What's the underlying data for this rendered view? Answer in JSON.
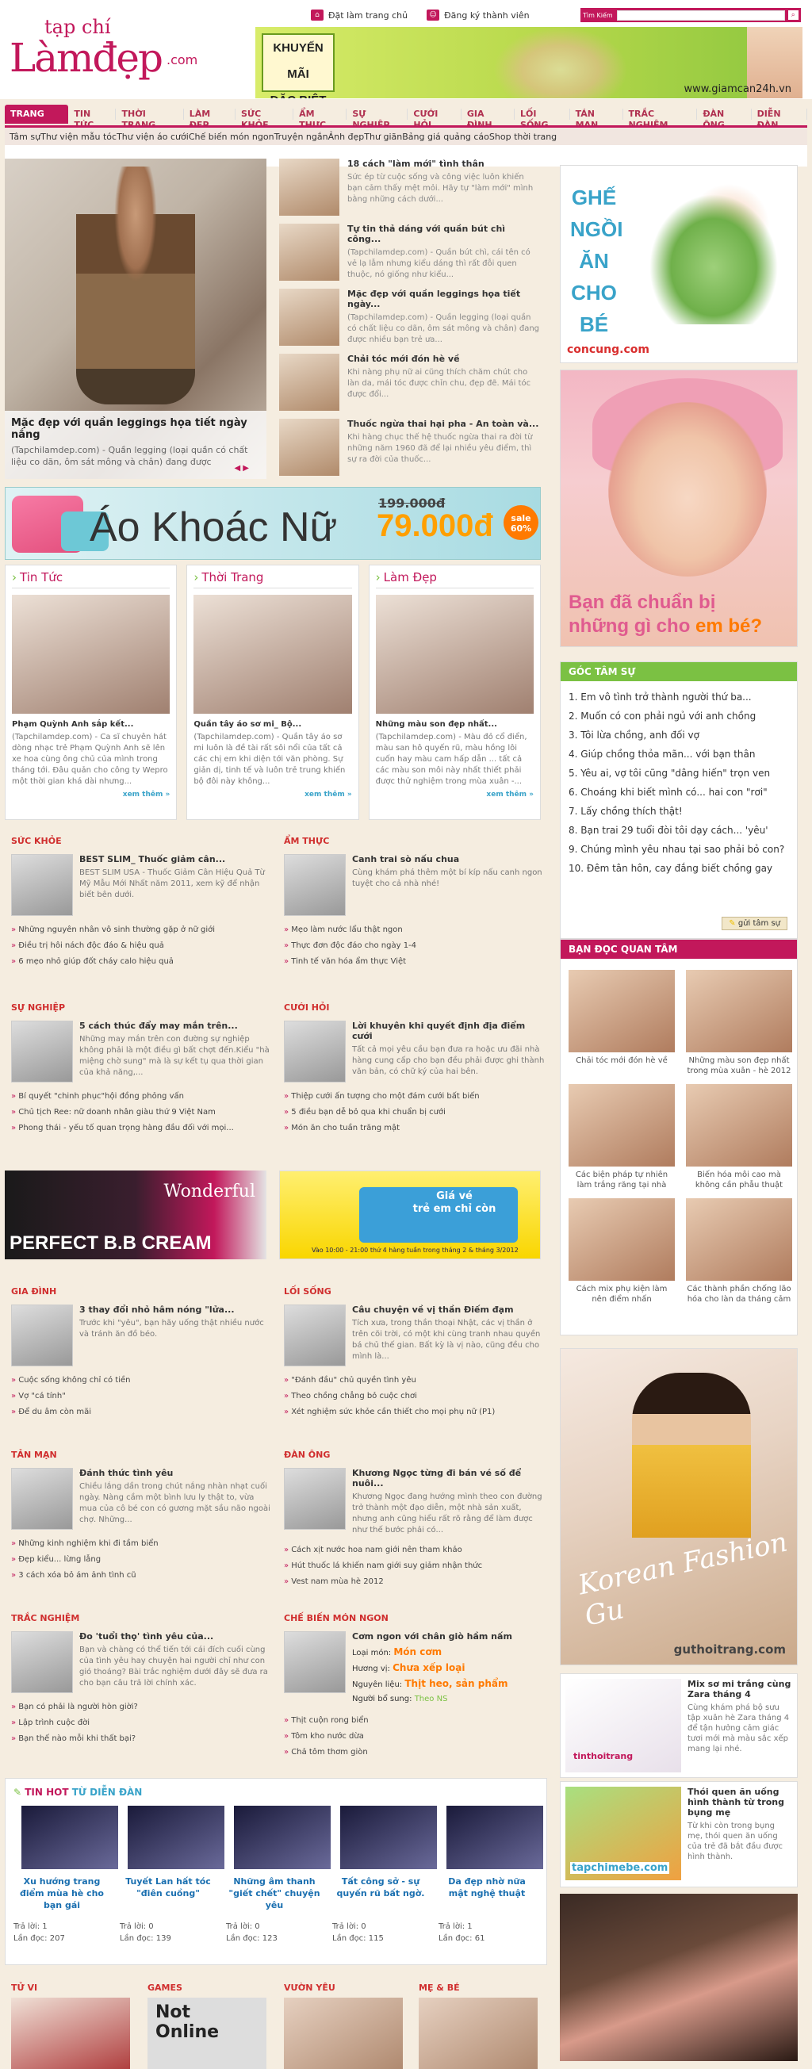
{
  "header": {
    "top_links": {
      "home": "Đặt làm trang chủ",
      "register": "Đăng ký thành viên"
    },
    "search": {
      "label": "Tìm Kiếm",
      "placeholder": ""
    },
    "logo": {
      "small": "tạp chí",
      "big": "Làmđẹp",
      "com": ".com"
    },
    "banner": {
      "line1": "KHUYẾN MÃI",
      "line2": "ĐẶC BIỆT",
      "site": "www.giamcan24h.vn"
    }
  },
  "nav": [
    "TRANG CHỦ",
    "TIN TỨC",
    "THỜI TRANG",
    "LÀM ĐẸP",
    "SỨC KHỎE",
    "ẨM THỰC",
    "SỰ NGHIỆP",
    "CƯỚI HỎI",
    "GIA ĐÌNH",
    "LỐI SỐNG",
    "TÁN MẠN",
    "TRẮC NGHIỆM",
    "ĐÀN ÔNG",
    "DIỄN ĐÀN"
  ],
  "subnav": [
    "Tâm sự",
    "Thư viện mẫu tóc",
    "Thư viện áo cưới",
    "Chế biến món ngon",
    "Truyện ngắn",
    "Ảnh đẹp",
    "Thư giãn",
    "Bảng giá quảng cáo",
    "Shop thời trang"
  ],
  "featured": {
    "title": "Mặc đẹp với quần leggings họa tiết ngày nắng",
    "desc": "(Tapchilamdep.com) - Quần legging (loại quần có chất liệu co dãn, ôm sát mông và chân) đang được"
  },
  "news": [
    {
      "title": "18 cách \"làm mới\" tình thân",
      "desc": "Sức ép từ cuộc sống và công việc luôn khiến bạn cảm thấy mệt mỏi. Hãy tự \"làm mới\" mình bằng những cách dưới..."
    },
    {
      "title": "Tự tin thả dáng với quần bút chì công...",
      "desc": "(Tapchilamdep.com) - Quần bút chì, cái tên có vẻ lạ lẫm nhưng kiểu dáng thì rất đỗi quen thuộc, nó giống như kiểu..."
    },
    {
      "title": "Mặc đẹp với quần leggings họa tiết ngày...",
      "desc": "(Tapchilamdep.com) - Quần legging (loại quần có chất liệu co dãn, ôm sát mông và chân) đang được nhiều bạn trẻ ưa..."
    },
    {
      "title": "Chải tóc mới đón hè về",
      "desc": "Khi nàng phụ nữ ai cũng thích chăm chút cho làn da, mái tóc được chỉn chu, đẹp đẽ. Mái tóc được đổi..."
    },
    {
      "title": "Thuốc ngừa thai hại pha - An toàn và...",
      "desc": "Khi hàng chục thế hệ thuốc ngừa thai ra đời từ những năm 1960 đã để lại nhiều yêu điểm, thì sự ra đời của thuốc..."
    }
  ],
  "long_banner": {
    "text": "Áo Khoác Nữ",
    "old_price": "199.000đ",
    "price": "79.000đ",
    "sale": "sale 60%"
  },
  "tri": [
    {
      "head": "Tin Tức",
      "title": "Phạm Quỳnh Anh sắp kết...",
      "desc": "(Tapchilamdep.com) - Ca sĩ chuyên hát dòng nhạc trẻ Phạm Quỳnh Anh sẽ lên xe hoa cùng ông chủ của mình trong tháng tới. Đâu quản cho công ty Wepro một thời gian khá dài nhưng...",
      "more": "xem thêm »"
    },
    {
      "head": "Thời Trang",
      "title": "Quần tây áo sơ mi_ Bộ...",
      "desc": "(Tapchilamdep.com) - Quần tây áo sơ mi luôn là đề tài rất sôi nổi của tất cả các chị em khi diện tới văn phòng. Sự giản dị, tinh tế và luôn trẻ trung khiến bộ đôi này không...",
      "more": "xem thêm »"
    },
    {
      "head": "Làm Đẹp",
      "title": "Những màu son đẹp nhất...",
      "desc": "(Tapchilamdep.com) - Màu đỏ cổ điển, màu san hô quyến rũ, màu hồng lôi cuốn hay màu cam hấp dẫn ... tất cả các màu son môi này nhất thiết phải được thử nghiệm trong mùa xuân -...",
      "more": "xem thêm »"
    }
  ],
  "cats": {
    "suckhoe": {
      "head": "SỨC KHỎE",
      "title": "BEST SLIM_ Thuốc giảm cân...",
      "desc": "BEST SLIM USA - Thuốc Giảm Cân Hiệu Quả Từ Mỹ Mẫu Mới Nhất năm 2011, xem kỹ để nhận biết bên dưới.",
      "items": [
        "Những nguyên nhân vô sinh thường gặp ở nữ giới",
        "Điều trị hôi nách độc đáo & hiệu quả",
        "6 mẹo nhỏ giúp đốt cháy calo hiệu quả"
      ]
    },
    "amthuc": {
      "head": "ẨM THỰC",
      "title": "Canh trai sò nấu chua",
      "desc": "Cùng khám phá thêm một bí kíp nấu canh ngon tuyệt cho cả nhà nhé!",
      "items": [
        "Mẹo làm nước lẩu thật ngon",
        "Thực đơn độc đáo cho ngày 1-4",
        "Tinh tế văn hóa ẩm thực Việt"
      ]
    },
    "sunghiep": {
      "head": "SỰ NGHIỆP",
      "title": "5 cách thúc đẩy may mắn trên...",
      "desc": "Những may mắn trên con đường sự nghiệp không phải là một điều gì bất chợt đến.Kiểu \"hà miệng chờ sung\" mà là sự kết tụ qua thời gian của khả năng,...",
      "items": [
        "Bí quyết \"chinh phục\"hội đồng phỏng vấn",
        "Chủ tịch Ree: nữ doanh nhân giàu thứ 9 Việt Nam",
        "Phong thái - yếu tố quan trọng hàng đầu đối với mọi..."
      ]
    },
    "cuoihoi": {
      "head": "CƯỚI HỎI",
      "title": "Lời khuyên khi quyết định địa điểm cưới",
      "desc": "Tất cả mọi yêu cầu bạn đưa ra hoặc ưu đãi nhà hàng cung cấp cho bạn đều phải được ghi thành văn bản, có chữ ký của hai bên.",
      "items": [
        "Thiệp cưới ấn tượng cho một đám cưới bất biến",
        "5 điều bạn dễ bỏ qua khi chuẩn bị cưới",
        "Món ăn cho tuần trăng mật"
      ]
    },
    "giadinh": {
      "head": "GIA ĐÌNH",
      "title": "3 thay đổi nhỏ hâm nóng \"lửa...",
      "desc": "Trước khi \"yêu\", bạn hãy uống thật nhiều nước và tránh ăn đồ béo.",
      "items": [
        "Cuộc sống không chỉ có tiền",
        "Vợ \"cá tính\"",
        "Để du âm còn mãi"
      ]
    },
    "loisong": {
      "head": "LỐI SỐNG",
      "title": "Câu chuyện về vị thần Điếm đạm",
      "desc": "Tích xưa, trong thần thoại Nhật, các vị thần ở trên cõi trời, có một khi cùng tranh nhau quyền bá chủ thế gian. Bất kỳ là vị nào, cũng đều cho mình là...",
      "items": [
        "\"Đánh đầu\" chủ quyền tình yêu",
        "Theo chồng chẳng bỏ cuộc chơi",
        "Xét nghiệm sức khỏe cần thiết cho mọi phụ nữ (P1)"
      ]
    },
    "tanman": {
      "head": "TẢN MẠN",
      "title": "Đánh thức tình yêu",
      "desc": "Chiều lắng dần trong chút nắng nhàn nhạt cuối ngày. Nàng cầm một bình lưu ly thật to, vừa mua của cô bé con có gương mặt sầu não ngoài chợ. Những...",
      "items": [
        "Những kinh nghiệm khi đi tầm biển",
        "Đẹp kiểu... lừng lẫng",
        "3 cách xóa bỏ ám ảnh tình cũ"
      ]
    },
    "danong": {
      "head": "ĐÀN ÔNG",
      "title": "Khương Ngọc từng đi bán vé số để nuôi...",
      "desc": "Khương Ngọc đang hướng mình theo con đường trở thành một đạo diễn, một nhà sản xuất, nhưng anh cũng hiểu rất rõ rằng để làm được như thế bước phải có...",
      "items": [
        "Cách xịt nước hoa nam giới nên tham khảo",
        "Hút thuốc lá khiến nam giới suy giảm nhận thức",
        "Vest nam mùa hè 2012"
      ]
    },
    "tracnghiem": {
      "head": "TRẮC NGHIỆM",
      "title": "Đo 'tuổi thọ' tình yêu của...",
      "desc": "Bạn và chàng có thể tiến tới cái đích cuối cùng của tình yêu hay chuyện hai người chỉ như con gió thoáng? Bài trắc nghiệm dưới đây sẽ đưa ra cho bạn câu trả lời chính xác.",
      "items": [
        "Bạn có phải là người hòn giời?",
        "Lập trình cuộc đời",
        "Bạn thế nào mỗi khi thất bại?"
      ]
    },
    "chebien": {
      "head": "CHẾ BIẾN MÓN NGON",
      "title": "Cơm ngon với chân giò hầm nấm",
      "loai_label": "Loại món:",
      "loai": "Món cơm",
      "huong_label": "Hương vị:",
      "huong": "Chưa xếp loại",
      "nl_label": "Nguyên liệu:",
      "nl": "Thịt heo, sản phẩm",
      "ng_label": "Người bổ sung:",
      "ng": "Theo NS",
      "items": [
        "Thịt cuộn rong biển",
        "Tôm kho nước dừa",
        "Chả tôm thơm giòn"
      ]
    }
  },
  "ads_row": {
    "left_text": "PERFECT B.B CREAM",
    "left_brand": "Wonderful",
    "right_line1": "Giá vé",
    "right_line2": "trẻ em chỉ còn",
    "right_foot": "Vào 10:00 - 21:00 thứ 4 hàng tuần trong tháng 2 & tháng 3/2012"
  },
  "forum": {
    "head": "TIN HOT",
    "head2": "TỪ DIỄN ĐÀN",
    "reply": "Trả lời:",
    "view": "Lần đọc:",
    "items": [
      {
        "title": "Xu hướng trang điểm mùa hè cho bạn gái",
        "r": "1",
        "v": "207"
      },
      {
        "title": "Tuyết Lan hất tóc \"điên cuồng\"",
        "r": "0",
        "v": "139"
      },
      {
        "title": "Những âm thanh \"giết chết\" chuyện yêu",
        "r": "0",
        "v": "123"
      },
      {
        "title": "Tất công sở - sự quyến rũ bất ngờ.",
        "r": "0",
        "v": "115"
      },
      {
        "title": "Da đẹp nhờ nữa mật nghệ thuật",
        "r": "1",
        "v": "61"
      }
    ]
  },
  "bottom": [
    "TỬ VI",
    "GAMES",
    "VƯỜN YÊU",
    "MẸ & BÉ"
  ],
  "bottom_game": "Not Online",
  "right": {
    "ad1_text": "GHẾ NGỒI ĂN CHO BÉ",
    "ad1_brand": "concung.com",
    "ad2_text1": "Bạn đã chuẩn bị",
    "ad2_text2": "những gì cho",
    "ad2_text3": "em bé?",
    "gts_head": "GÓC TÂM SỰ",
    "gts": [
      "1. Em vô tình trở thành người thứ ba...",
      "2. Muốn có con phải ngủ với anh chồng",
      "3. Tôi lừa chồng, anh đối vợ",
      "4. Giúp chồng thỏa mãn... với bạn thân",
      "5. Yêu ai, vợ tôi cũng \"dâng hiến\" trọn ven",
      "6. Choáng khi biết mình có... hai con \"rơi\"",
      "7. Lấy chồng thích thật!",
      "8. Bạn trai 29 tuổi đòi tôi dạy cách... 'yêu'",
      "9. Chúng mình yêu nhau tại sao phải bỏ con?",
      "10. Đêm tân hôn, cay đắng biết chồng gay"
    ],
    "gts_btn": "gửi tâm sự",
    "bdqt_head": "BẠN ĐỌC QUAN TÂM",
    "bdqt": [
      "Chải tóc mới đón hè về",
      "Những màu son đẹp nhất trong mùa xuân - hè 2012",
      "Các biện pháp tự nhiên làm trắng răng tại nhà",
      "Biến hóa môi cao mà không cần phẫu thuật",
      "Cách mix phụ kiện làm nên điểm nhấn",
      "Các thành phần chống lão hóa cho làn da tháng cảm"
    ],
    "korean": "Korean Fashion",
    "korean_gu": "Gu",
    "korean_site": "guthoitrang.com",
    "p1_title": "Mix sơ mi trắng cùng Zara tháng 4",
    "p1_desc": "Cùng khám phá bộ sưu tập xuân hè Zara tháng 4 để tận hưởng cảm giác tươi mới mà màu sắc xếp mang lại nhé.",
    "p1_brand": "tinthoitrang",
    "p2_title": "Thói quen ăn uống hình thành từ trong bụng mẹ",
    "p2_desc": "Từ khi còn trong bụng mẹ, thói quen ăn uống của trẻ đã bắt đầu được hình thành.",
    "p2_brand": "tapchimebe.com"
  }
}
